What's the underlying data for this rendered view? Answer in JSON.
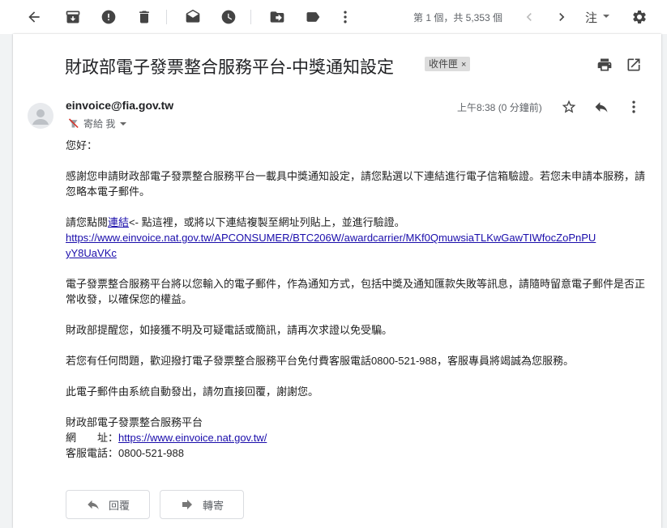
{
  "toolbar": {
    "icons": [
      "back-arrow-icon",
      "archive-icon",
      "report-spam-icon",
      "delete-icon",
      "mark-unread-icon",
      "snooze-icon",
      "move-to-icon",
      "label-icon",
      "more-vert-icon"
    ],
    "pager_text": "第 1 個，共 5,353 個",
    "lang_label": "注"
  },
  "email": {
    "subject": "財政部電子發票整合服務平台-中獎通知設定",
    "label": "收件匣",
    "label_close": "×",
    "sender": "einvoice@fia.gov.tw",
    "to": "寄給 我",
    "time": "上午8:38 (0 分鐘前)",
    "greeting": "您好：",
    "para1": "感謝您申請財政部電子發票整合服務平台一載具中獎通知設定，請您點選以下連結進行電子信箱驗證。若您未申請本服務，請忽略本電子郵件。",
    "para2_prefix": "請您點閱",
    "para2_link": "連結",
    "para2_suffix": "<- 點這裡，或將以下連結複製至網址列貼上，並進行驗證。",
    "long_link": "https://www.einvoice.nat.gov.tw/APCONSUMER/BTC206W/awardcarrier/MKf0QmuwsiaTLKwGawTIWfocZoPnPUyY8UaVKc",
    "long_link_line1": "https://www.einvoice.nat.gov.tw/APCONSUMER/BTC206W/awardcarrier/MKf0QmuwsiaTLKwGawTIWfocZoPnPU",
    "long_link_line2": "yY8UaVKc",
    "para3": "電子發票整合服務平台將以您輸入的電子郵件，作為通知方式，包括中獎及通知匯款失敗等訊息，請隨時留意電子郵件是否正常收發，以確保您的權益。",
    "para4": "財政部提醒您，如接獲不明及可疑電話或簡訊，請再次求證以免受騙。",
    "para5": "若您有任何問題，歡迎撥打電子發票整合服務平台免付費客服電話0800-521-988，客服專員將竭誠為您服務。",
    "para6": "此電子郵件由系統自動發出，請勿直接回覆，謝謝您。",
    "sig_name": "財政部電子發票整合服務平台",
    "sig_site_label": "網　　址：",
    "sig_site_url": "https://www.einvoice.nat.gov.tw/",
    "sig_phone": "客服電話：0800-521-988"
  },
  "buttons": {
    "reply": "回覆",
    "forward": "轉寄"
  }
}
